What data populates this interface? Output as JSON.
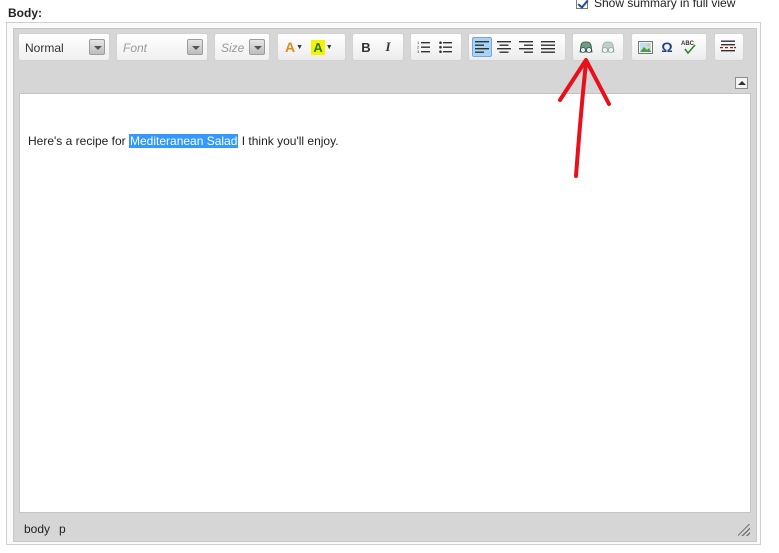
{
  "field_label": "Body:",
  "summary_toggle": {
    "label": "Show summary in full view",
    "checked": true
  },
  "toolbar": {
    "format_combo": "Normal",
    "font_combo": "Font",
    "size_combo": "Size",
    "text_color_glyph": "A",
    "bg_color_glyph": "A",
    "bold_glyph": "B",
    "italic_glyph": "I",
    "special_char_glyph": "Ω",
    "spellcheck_glyph": "ABC"
  },
  "content": {
    "before": "Here's a recipe for ",
    "selected": "Mediteranean Salad",
    "after": " I think you'll enjoy."
  },
  "status_path": [
    "body",
    "p"
  ],
  "colors": {
    "selection": "#3399ff",
    "annotation_arrow": "#e8101a",
    "active_button": "#a9d3f5"
  }
}
